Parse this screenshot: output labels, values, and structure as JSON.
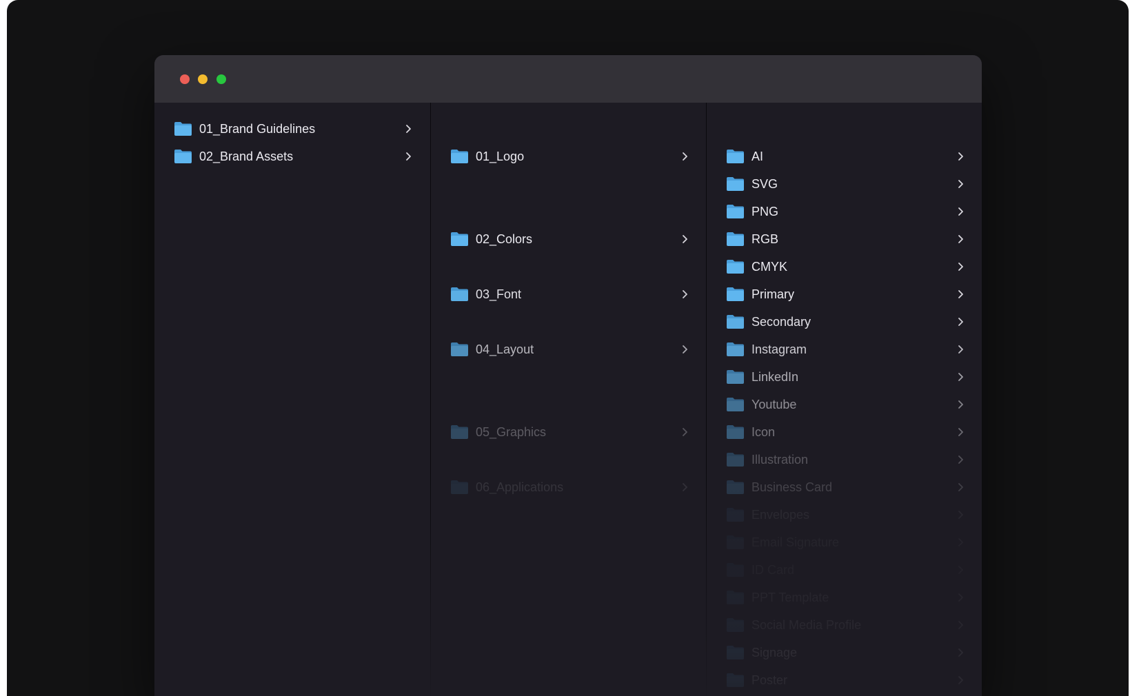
{
  "window": {
    "traffic_lights": {
      "close_color": "#ed5f57",
      "minimize_color": "#f3bb2f",
      "zoom_color": "#28c73f"
    }
  },
  "columns": [
    {
      "items": [
        {
          "label": "01_Brand Guidelines",
          "icon": "folder-icon"
        },
        {
          "label": "02_Brand Assets",
          "icon": "folder-icon"
        }
      ]
    },
    {
      "items": [
        {
          "label": "01_Logo",
          "icon": "folder-icon"
        },
        {
          "label": "02_Colors",
          "icon": "folder-icon"
        },
        {
          "label": "03_Font",
          "icon": "folder-icon"
        },
        {
          "label": "04_Layout",
          "icon": "folder-icon"
        },
        {
          "label": "05_Graphics",
          "icon": "folder-icon"
        },
        {
          "label": "06_Applications",
          "icon": "folder-icon"
        }
      ]
    },
    {
      "items": [
        {
          "label": "AI",
          "icon": "folder-icon"
        },
        {
          "label": "SVG",
          "icon": "folder-icon"
        },
        {
          "label": "PNG",
          "icon": "folder-icon"
        },
        {
          "label": "RGB",
          "icon": "folder-icon"
        },
        {
          "label": "CMYK",
          "icon": "folder-icon"
        },
        {
          "label": "Primary",
          "icon": "folder-icon"
        },
        {
          "label": "Secondary",
          "icon": "folder-icon"
        },
        {
          "label": "Instagram",
          "icon": "folder-icon"
        },
        {
          "label": "LinkedIn",
          "icon": "folder-icon"
        },
        {
          "label": "Youtube",
          "icon": "folder-icon"
        },
        {
          "label": "Icon",
          "icon": "folder-icon"
        },
        {
          "label": "Illustration",
          "icon": "folder-icon"
        },
        {
          "label": "Business Card",
          "icon": "folder-icon"
        },
        {
          "label": "Envelopes",
          "icon": "folder-icon"
        },
        {
          "label": "Email Signature",
          "icon": "folder-icon"
        },
        {
          "label": "ID Card",
          "icon": "folder-icon"
        },
        {
          "label": "PPT Template",
          "icon": "folder-icon"
        },
        {
          "label": "Social Media Profile",
          "icon": "folder-icon"
        },
        {
          "label": "Signage",
          "icon": "folder-icon"
        },
        {
          "label": "Poster",
          "icon": "folder-icon"
        }
      ]
    }
  ],
  "colors": {
    "folder": "#5fb6ef",
    "folder_tab": "#4a9fdb",
    "text": "#ecebf1",
    "chevron": "#d8d7de"
  }
}
